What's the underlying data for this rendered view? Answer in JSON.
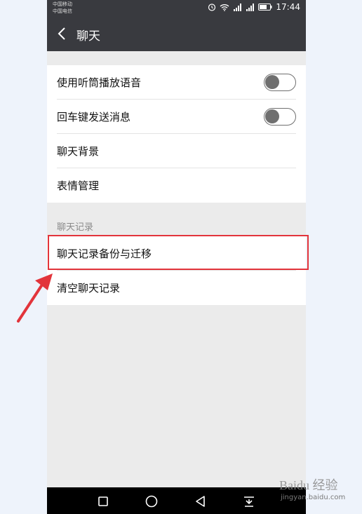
{
  "status_bar": {
    "carrier_1": "中国移动",
    "carrier_2": "中国电信",
    "time": "17:44"
  },
  "header": {
    "title": "聊天"
  },
  "settings_group_1": {
    "items": [
      {
        "label": "使用听筒播放语音",
        "toggle": false
      },
      {
        "label": "回车键发送消息",
        "toggle": false
      },
      {
        "label": "聊天背景"
      },
      {
        "label": "表情管理"
      }
    ]
  },
  "chat_history_section": {
    "header": "聊天记录",
    "items": [
      {
        "label": "聊天记录备份与迁移"
      },
      {
        "label": "清空聊天记录"
      }
    ]
  },
  "watermark": {
    "logo": "Baidu 经验",
    "url": "jingyan.baidu.com"
  },
  "colors": {
    "titlebar": "#393a3f",
    "highlight": "#e2343b",
    "background": "#ebebeb"
  }
}
